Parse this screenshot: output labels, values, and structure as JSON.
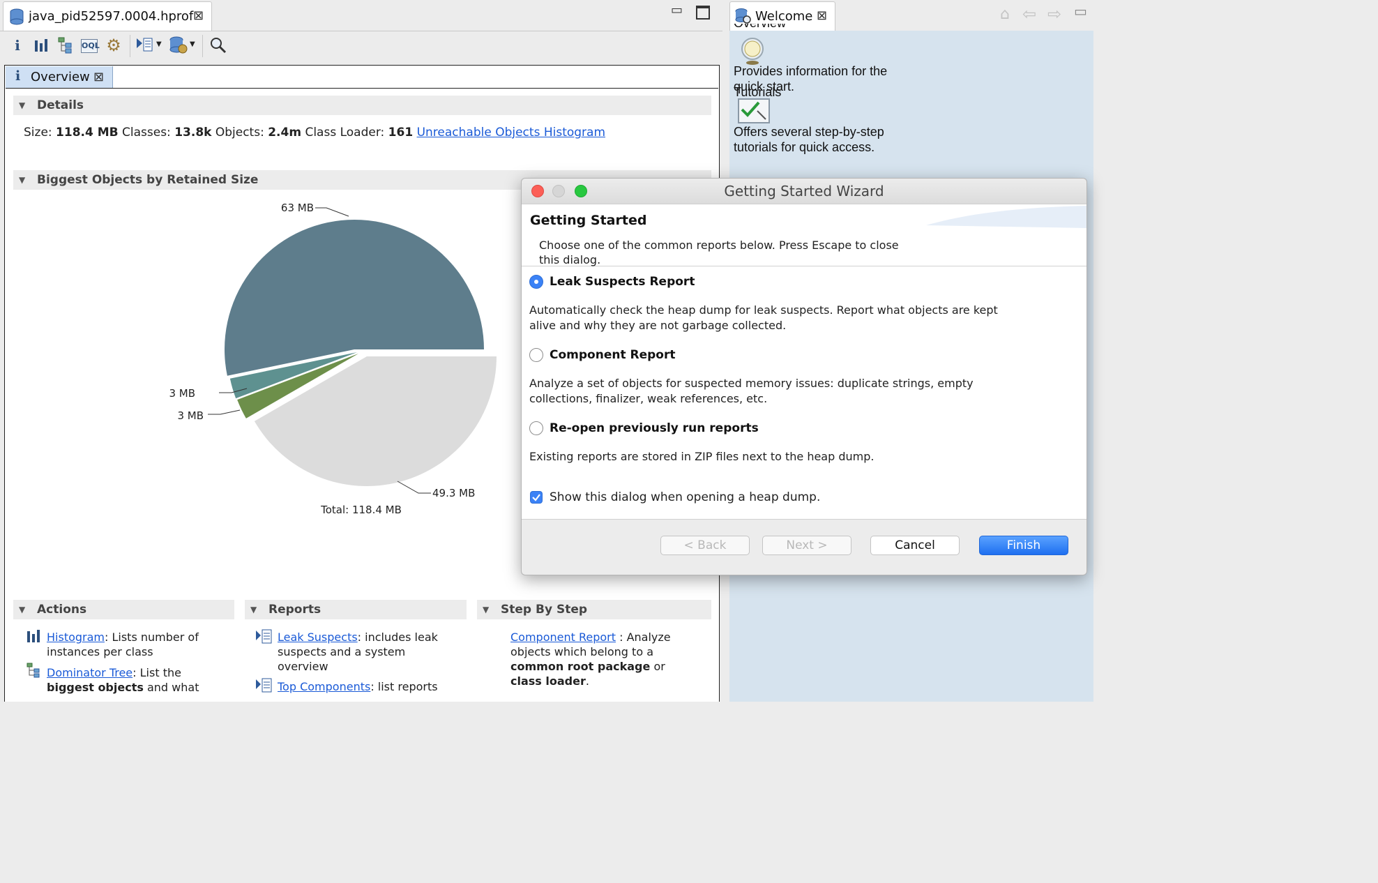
{
  "editor": {
    "tab_title": "java_pid52597.0004.hprof",
    "overview_tab": "Overview",
    "details": {
      "heading": "Details",
      "size_label": "Size:",
      "size_value": "118.4 MB",
      "classes_label": "Classes:",
      "classes_value": "13.8k",
      "objects_label": "Objects:",
      "objects_value": "2.4m",
      "loader_label": "Class Loader:",
      "loader_value": "161",
      "unreachable_link": "Unreachable Objects Histogram"
    },
    "biggest_heading": "Biggest Objects by Retained Size",
    "chart_data": {
      "type": "pie",
      "title": "",
      "slices": [
        {
          "label": "63 MB",
          "value": 63,
          "color": "#5e7d8c"
        },
        {
          "label": "3 MB",
          "value": 3,
          "color": "#5e9190"
        },
        {
          "label": "3 MB",
          "value": 3,
          "color": "#6d8f4a"
        },
        {
          "label": "49.3 MB",
          "value": 49.3,
          "color": "#dcdcdc"
        }
      ],
      "total_label": "Total: 118.4 MB"
    },
    "actions": {
      "heading": "Actions",
      "histogram_link": "Histogram",
      "histogram_text_a": ": Lists number of",
      "histogram_text_b": "instances per class",
      "dominator_link": "Dominator Tree",
      "dominator_text_a": ": List the",
      "dominator_bold": "biggest objects",
      "dominator_text_b": "and what"
    },
    "reports": {
      "heading": "Reports",
      "leak_link": "Leak Suspects",
      "leak_text_a": ": includes leak",
      "leak_text_b": "suspects and a system",
      "leak_text_c": "overview",
      "top_link": "Top Components",
      "top_text_a": ": list reports"
    },
    "stepbystep": {
      "heading": "Step By Step",
      "comp_link": "Component Report",
      "comp_text_a": ": Analyze",
      "comp_text_b": "objects which belong to a",
      "comp_bold_a": "common root package",
      "comp_text_c": "or",
      "comp_bold_b": "class loader",
      "comp_text_d": "."
    }
  },
  "welcome": {
    "tab_title": "Welcome",
    "overview_heading": "Overview",
    "overview_text_a": "Provides information for the",
    "overview_text_b": "quick start.",
    "tutorials_heading": "Tutorials",
    "tutorials_text_a": "Offers several step-by-step",
    "tutorials_text_b": "tutorials for quick access."
  },
  "dialog": {
    "title": "Getting Started Wizard",
    "heading": "Getting Started",
    "intro_a": "Choose one of the common reports below. Press Escape to close",
    "intro_b": "this dialog.",
    "options": [
      {
        "label": "Leak Suspects Report",
        "selected": true,
        "desc_a": "Automatically check the heap dump for leak suspects. Report what objects are kept",
        "desc_b": "alive and why they are not garbage collected."
      },
      {
        "label": "Component Report",
        "selected": false,
        "desc_a": "Analyze a set of objects for suspected memory issues: duplicate strings, empty",
        "desc_b": "collections, finalizer, weak references, etc."
      },
      {
        "label": "Re-open previously run reports",
        "selected": false,
        "desc_a": "Existing reports are stored in ZIP files next to the heap dump."
      }
    ],
    "show_checkbox": "Show this dialog when opening a heap dump.",
    "show_checked": true,
    "buttons": {
      "back": "< Back",
      "next": "Next >",
      "cancel": "Cancel",
      "finish": "Finish"
    }
  }
}
